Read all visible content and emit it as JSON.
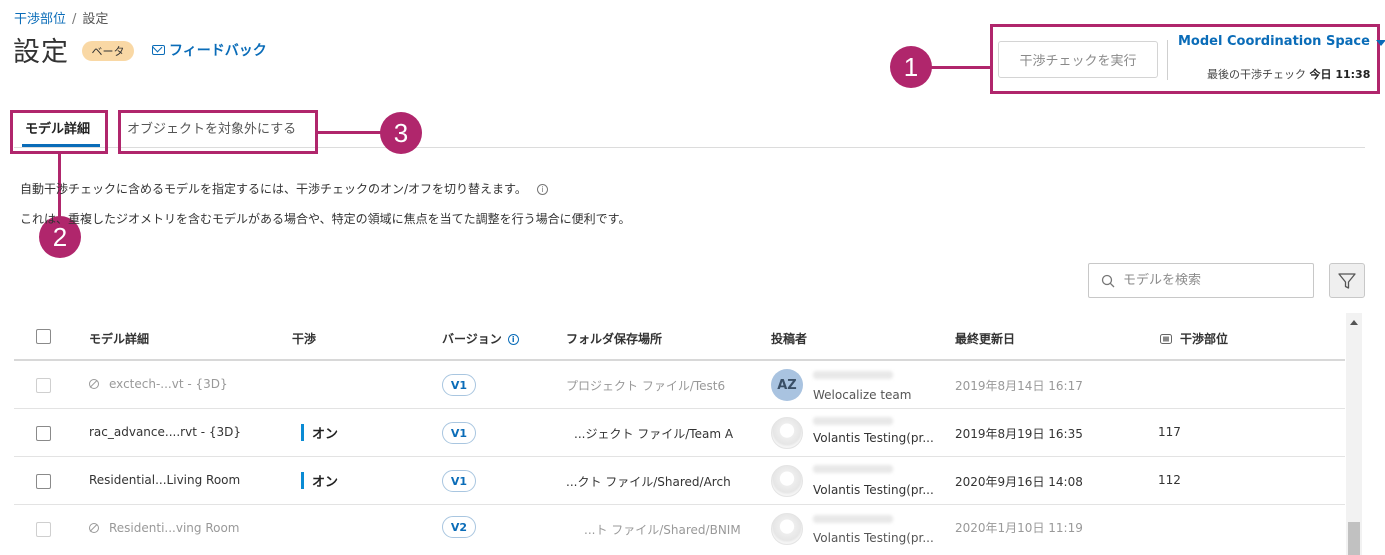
{
  "breadcrumb": {
    "parent": "干渉部位",
    "separator": "/",
    "current": "設定"
  },
  "header": {
    "title": "設定",
    "beta_label": "ベータ",
    "feedback_label": "フィードバック",
    "run_button_label": "干渉チェックを実行",
    "space_name": "Model Coordination Space",
    "last_check_label": "最後の干渉チェック",
    "last_check_time": "今日 11:38"
  },
  "tabs": [
    {
      "label": "モデル詳細",
      "active": true
    },
    {
      "label": "オブジェクトを対象外にする",
      "active": false
    }
  ],
  "description": {
    "line1": "自動干渉チェックに含めるモデルを指定するには、干渉チェックのオン/オフを切り替えます。",
    "line2": "これは、重複したジオメトリを含むモデルがある場合や、特定の領域に焦点を当てた調整を行う場合に便利です。"
  },
  "callouts": [
    "1",
    "2",
    "3"
  ],
  "search": {
    "placeholder": "モデルを検索"
  },
  "table": {
    "headers": {
      "model": "モデル詳細",
      "clash": "干渉",
      "version": "バージョン",
      "folder": "フォルダ保存場所",
      "author": "投稿者",
      "updated": "最終更新日",
      "clash_count": "干渉部位"
    },
    "rows": [
      {
        "name": "exctech-...vt - {3D}",
        "excluded": true,
        "on_label": "",
        "version": "V1",
        "folder": "プロジェクト ファイル/Test6",
        "avatar_initials": "AZ",
        "team": "Welocalize team",
        "updated": "2019年8月14日 16:17",
        "clash_count": ""
      },
      {
        "name": "rac_advance....rvt - {3D}",
        "excluded": false,
        "on_label": "オン",
        "version": "V1",
        "folder": "...ジェクト ファイル/Team A",
        "avatar_initials": "",
        "team": "Volantis Testing(pr...",
        "updated": "2019年8月19日 16:35",
        "clash_count": "117"
      },
      {
        "name": "Residential...Living Room",
        "excluded": false,
        "on_label": "オン",
        "version": "V1",
        "folder": "...クト ファイル/Shared/Arch",
        "avatar_initials": "",
        "team": "Volantis Testing(pr...",
        "updated": "2020年9月16日 14:08",
        "clash_count": "112"
      },
      {
        "name": "Residenti...ving Room",
        "excluded": true,
        "on_label": "",
        "version": "V2",
        "folder": "...ト ファイル/Shared/BNIM",
        "avatar_initials": "",
        "team": "Volantis Testing(pr...",
        "updated": "2020年1月10日 11:19",
        "clash_count": ""
      }
    ]
  },
  "colors": {
    "accent": "#0a6cb8",
    "callout": "#b0266c",
    "beta_bg": "#f9d8a5",
    "toggle_on": "#0a8bd4"
  }
}
